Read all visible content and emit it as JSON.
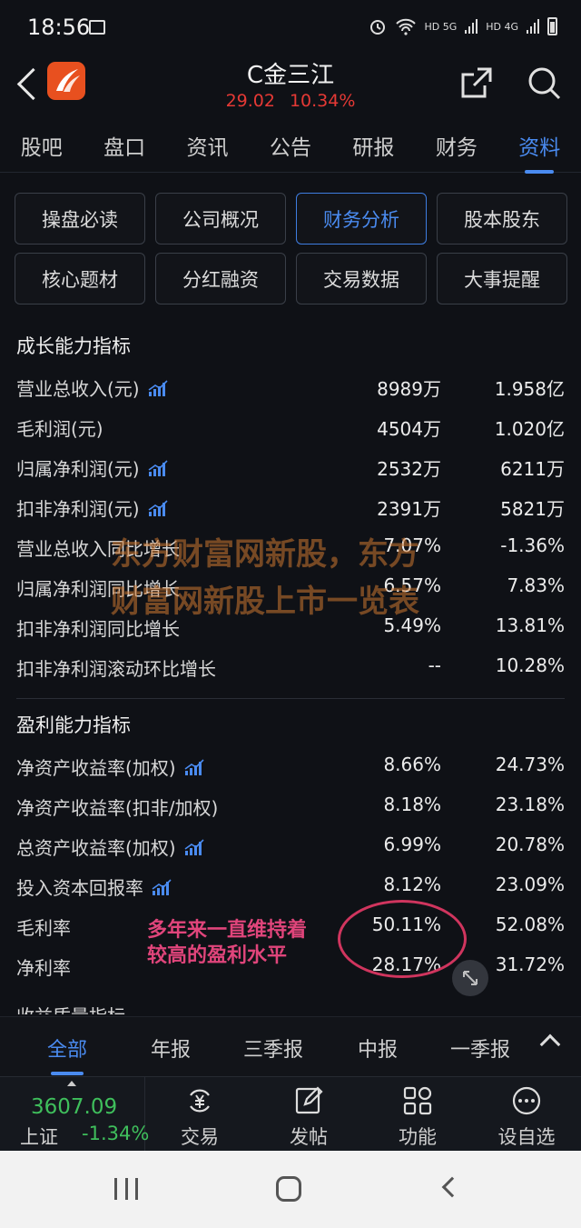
{
  "status_bar": {
    "time": "18:56",
    "net1": "HD 5G",
    "net2": "HD 4G"
  },
  "header": {
    "title": "C金三江",
    "price": "29.02",
    "change_pct": "10.34%"
  },
  "tabs": [
    "股吧",
    "盘口",
    "资讯",
    "公告",
    "研报",
    "财务",
    "资料"
  ],
  "grid_buttons": [
    "操盘必读",
    "公司概况",
    "财务分析",
    "股本股东",
    "核心题材",
    "分红融资",
    "交易数据",
    "大事提醒"
  ],
  "sections": {
    "growth": {
      "title": "成长能力指标",
      "rows": [
        {
          "label": "营业总收入(元)",
          "v1": "8989万",
          "v2": "1.958亿"
        },
        {
          "label": "毛利润(元)",
          "v1": "4504万",
          "v2": "1.020亿"
        },
        {
          "label": "归属净利润(元)",
          "v1": "2532万",
          "v2": "6211万"
        },
        {
          "label": "扣非净利润(元)",
          "v1": "2391万",
          "v2": "5821万"
        },
        {
          "label": "营业总收入同比增长",
          "v1": "7.07%",
          "v2": "-1.36%"
        },
        {
          "label": "归属净利润同比增长",
          "v1": "6.57%",
          "v2": "7.83%"
        },
        {
          "label": "扣非净利润同比增长",
          "v1": "5.49%",
          "v2": "13.81%"
        },
        {
          "label": "扣非净利润滚动环比增长",
          "v1": "--",
          "v2": "10.28%"
        }
      ]
    },
    "profit": {
      "title": "盈利能力指标",
      "rows": [
        {
          "label": "净资产收益率(加权)",
          "v1": "8.66%",
          "v2": "24.73%"
        },
        {
          "label": "净资产收益率(扣非/加权)",
          "v1": "8.18%",
          "v2": "23.18%"
        },
        {
          "label": "总资产收益率(加权)",
          "v1": "6.99%",
          "v2": "20.78%"
        },
        {
          "label": "投入资本回报率",
          "v1": "8.12%",
          "v2": "23.09%"
        },
        {
          "label": "毛利率",
          "v1": "50.11%",
          "v2": "52.08%"
        },
        {
          "label": "净利率",
          "v1": "28.17%",
          "v2": "31.72%"
        }
      ]
    },
    "next_clipped": "收益质量指标"
  },
  "watermark": {
    "line1": "东方财富网新股，东方",
    "line2": "财富网新股上市一览表"
  },
  "annotation": {
    "line1": "多年来一直维持着",
    "line2": "较高的盈利水平"
  },
  "period_tabs": [
    "全部",
    "年报",
    "三季报",
    "中报",
    "一季报"
  ],
  "index": {
    "value": "3607.09",
    "name": "上证",
    "change": "-1.34%"
  },
  "bottom_nav": [
    "交易",
    "发帖",
    "功能",
    "自选"
  ],
  "bottom_nav_prefix": "设",
  "colors": {
    "accent": "#4a8bf0",
    "up": "#e53935",
    "down": "#3fbf5c",
    "annotation": "#e0457b"
  }
}
